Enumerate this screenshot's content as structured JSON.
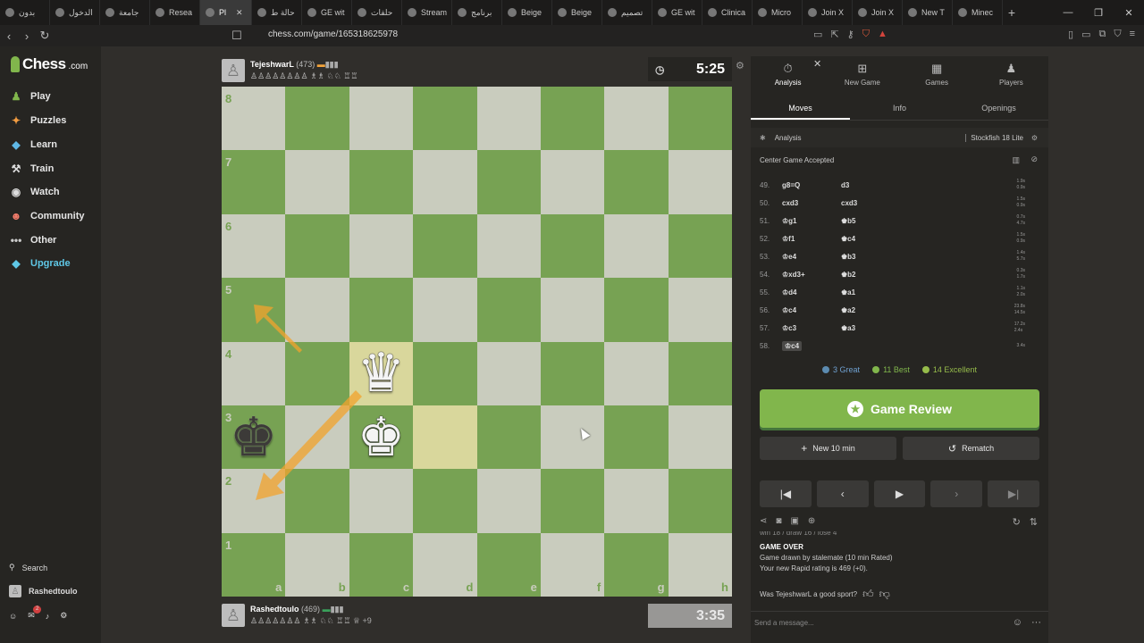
{
  "browser": {
    "tabs": [
      {
        "label": "بدون"
      },
      {
        "label": "الدخول"
      },
      {
        "label": "جامعة"
      },
      {
        "label": "Resea"
      },
      {
        "label": "Pl",
        "active": true
      },
      {
        "label": "حالة ط"
      },
      {
        "label": "GE wit"
      },
      {
        "label": "حلقات"
      },
      {
        "label": "Stream"
      },
      {
        "label": "برنامج"
      },
      {
        "label": "Beige"
      },
      {
        "label": "Beige"
      },
      {
        "label": "تصميم"
      },
      {
        "label": "GE wit"
      },
      {
        "label": "Clinica"
      },
      {
        "label": "Micro"
      },
      {
        "label": "Join X"
      },
      {
        "label": "Join X"
      },
      {
        "label": "New T"
      },
      {
        "label": "Minec"
      }
    ],
    "url": "chess.com/game/165318625978"
  },
  "sidebar": {
    "logo": "Chess",
    "logo_suffix": ".com",
    "items": [
      {
        "label": "Play",
        "icon": "play-icon"
      },
      {
        "label": "Puzzles",
        "icon": "puzzle-icon"
      },
      {
        "label": "Learn",
        "icon": "learn-icon"
      },
      {
        "label": "Train",
        "icon": "train-icon"
      },
      {
        "label": "Watch",
        "icon": "watch-icon"
      },
      {
        "label": "Community",
        "icon": "community-icon"
      },
      {
        "label": "Other",
        "icon": "more-icon"
      },
      {
        "label": "Upgrade",
        "icon": "diamond-icon"
      }
    ],
    "search_label": "Search",
    "username": "Rashedtoulo",
    "notification_count": "2"
  },
  "top_player": {
    "name": "TejeshwarL",
    "rating": "(473)",
    "captured": "♙♙♙♙♙♙♙♙ ♗♗ ♘♘ ♖♖",
    "clock": "5:25"
  },
  "bottom_player": {
    "name": "Rashedtoulo",
    "rating": "(469)",
    "captured": "♙♙♙♙♙♙♙ ♗♗ ♘♘ ♖♖ ♕",
    "advantage": "+9",
    "clock": "3:35"
  },
  "board": {
    "ranks": [
      "8",
      "7",
      "6",
      "5",
      "4",
      "3",
      "2",
      "1"
    ],
    "files": [
      "a",
      "b",
      "c",
      "d",
      "e",
      "f",
      "g",
      "h"
    ],
    "pieces": {
      "c4": {
        "glyph": "♛",
        "color": "white"
      },
      "c3": {
        "glyph": "♚",
        "color": "white"
      },
      "a3": {
        "glyph": "♚",
        "color": "black"
      }
    },
    "highlight": [
      "c4",
      "d3"
    ]
  },
  "panel": {
    "top_tabs": [
      {
        "label": "Analysis",
        "icon": "stopwatch-icon"
      },
      {
        "label": "New Game",
        "icon": "plus-icon"
      },
      {
        "label": "Games",
        "icon": "grid-icon"
      },
      {
        "label": "Players",
        "icon": "players-icon"
      }
    ],
    "sub_tabs": [
      "Moves",
      "Info",
      "Openings"
    ],
    "analysis_label": "Analysis",
    "engine": "Stockfish 18 Lite",
    "opening": "Center Game Accepted",
    "moves": [
      {
        "n": "49.",
        "w": "g8=Q",
        "b": "d3",
        "tw": "1.9s",
        "tb": "0.9s"
      },
      {
        "n": "50.",
        "w": "cxd3",
        "b": "cxd3",
        "tw": "1.5s",
        "tb": "0.9s"
      },
      {
        "n": "51.",
        "w": "♔g1",
        "b": "♚b5",
        "tw": "0.7s",
        "tb": "4.7s"
      },
      {
        "n": "52.",
        "w": "♔f1",
        "b": "♚c4",
        "tw": "1.5s",
        "tb": "0.9s"
      },
      {
        "n": "53.",
        "w": "♔e4",
        "b": "♚b3",
        "tw": "1.4s",
        "tb": "5.7s"
      },
      {
        "n": "54.",
        "w": "♔xd3+",
        "b": "♚b2",
        "tw": "0.3s",
        "tb": "1.7s"
      },
      {
        "n": "55.",
        "w": "♔d4",
        "b": "♚a1",
        "tw": "1.1s",
        "tb": "2.0s"
      },
      {
        "n": "56.",
        "w": "♔c4",
        "b": "♚a2",
        "tw": "23.8s",
        "tb": "14.5s"
      },
      {
        "n": "57.",
        "w": "♔c3",
        "b": "♚a3",
        "tw": "17.2s",
        "tb": "2.4s"
      },
      {
        "n": "58.",
        "w": "♔c4",
        "b": "",
        "tw": "3.4s",
        "tb": ""
      }
    ],
    "summary": [
      {
        "label": "3 Great",
        "color": "#5c8bb0"
      },
      {
        "label": "11 Best",
        "color": "#81b64c"
      },
      {
        "label": "14 Excellent",
        "color": "#96bc4b"
      }
    ],
    "review_label": "Game Review",
    "new_game_label": "New 10 min",
    "rematch_label": "Rematch",
    "record_line": "win 18 / draw 16 / lose 4",
    "game_over_title": "GAME OVER",
    "game_over_text": "Game drawn by stalemate (10 min Rated)",
    "rating_text": "Your new Rapid rating is 469 (+0).",
    "sport_question": "Was TejeshwarL a good sport?",
    "chat_placeholder": "Send a message..."
  }
}
